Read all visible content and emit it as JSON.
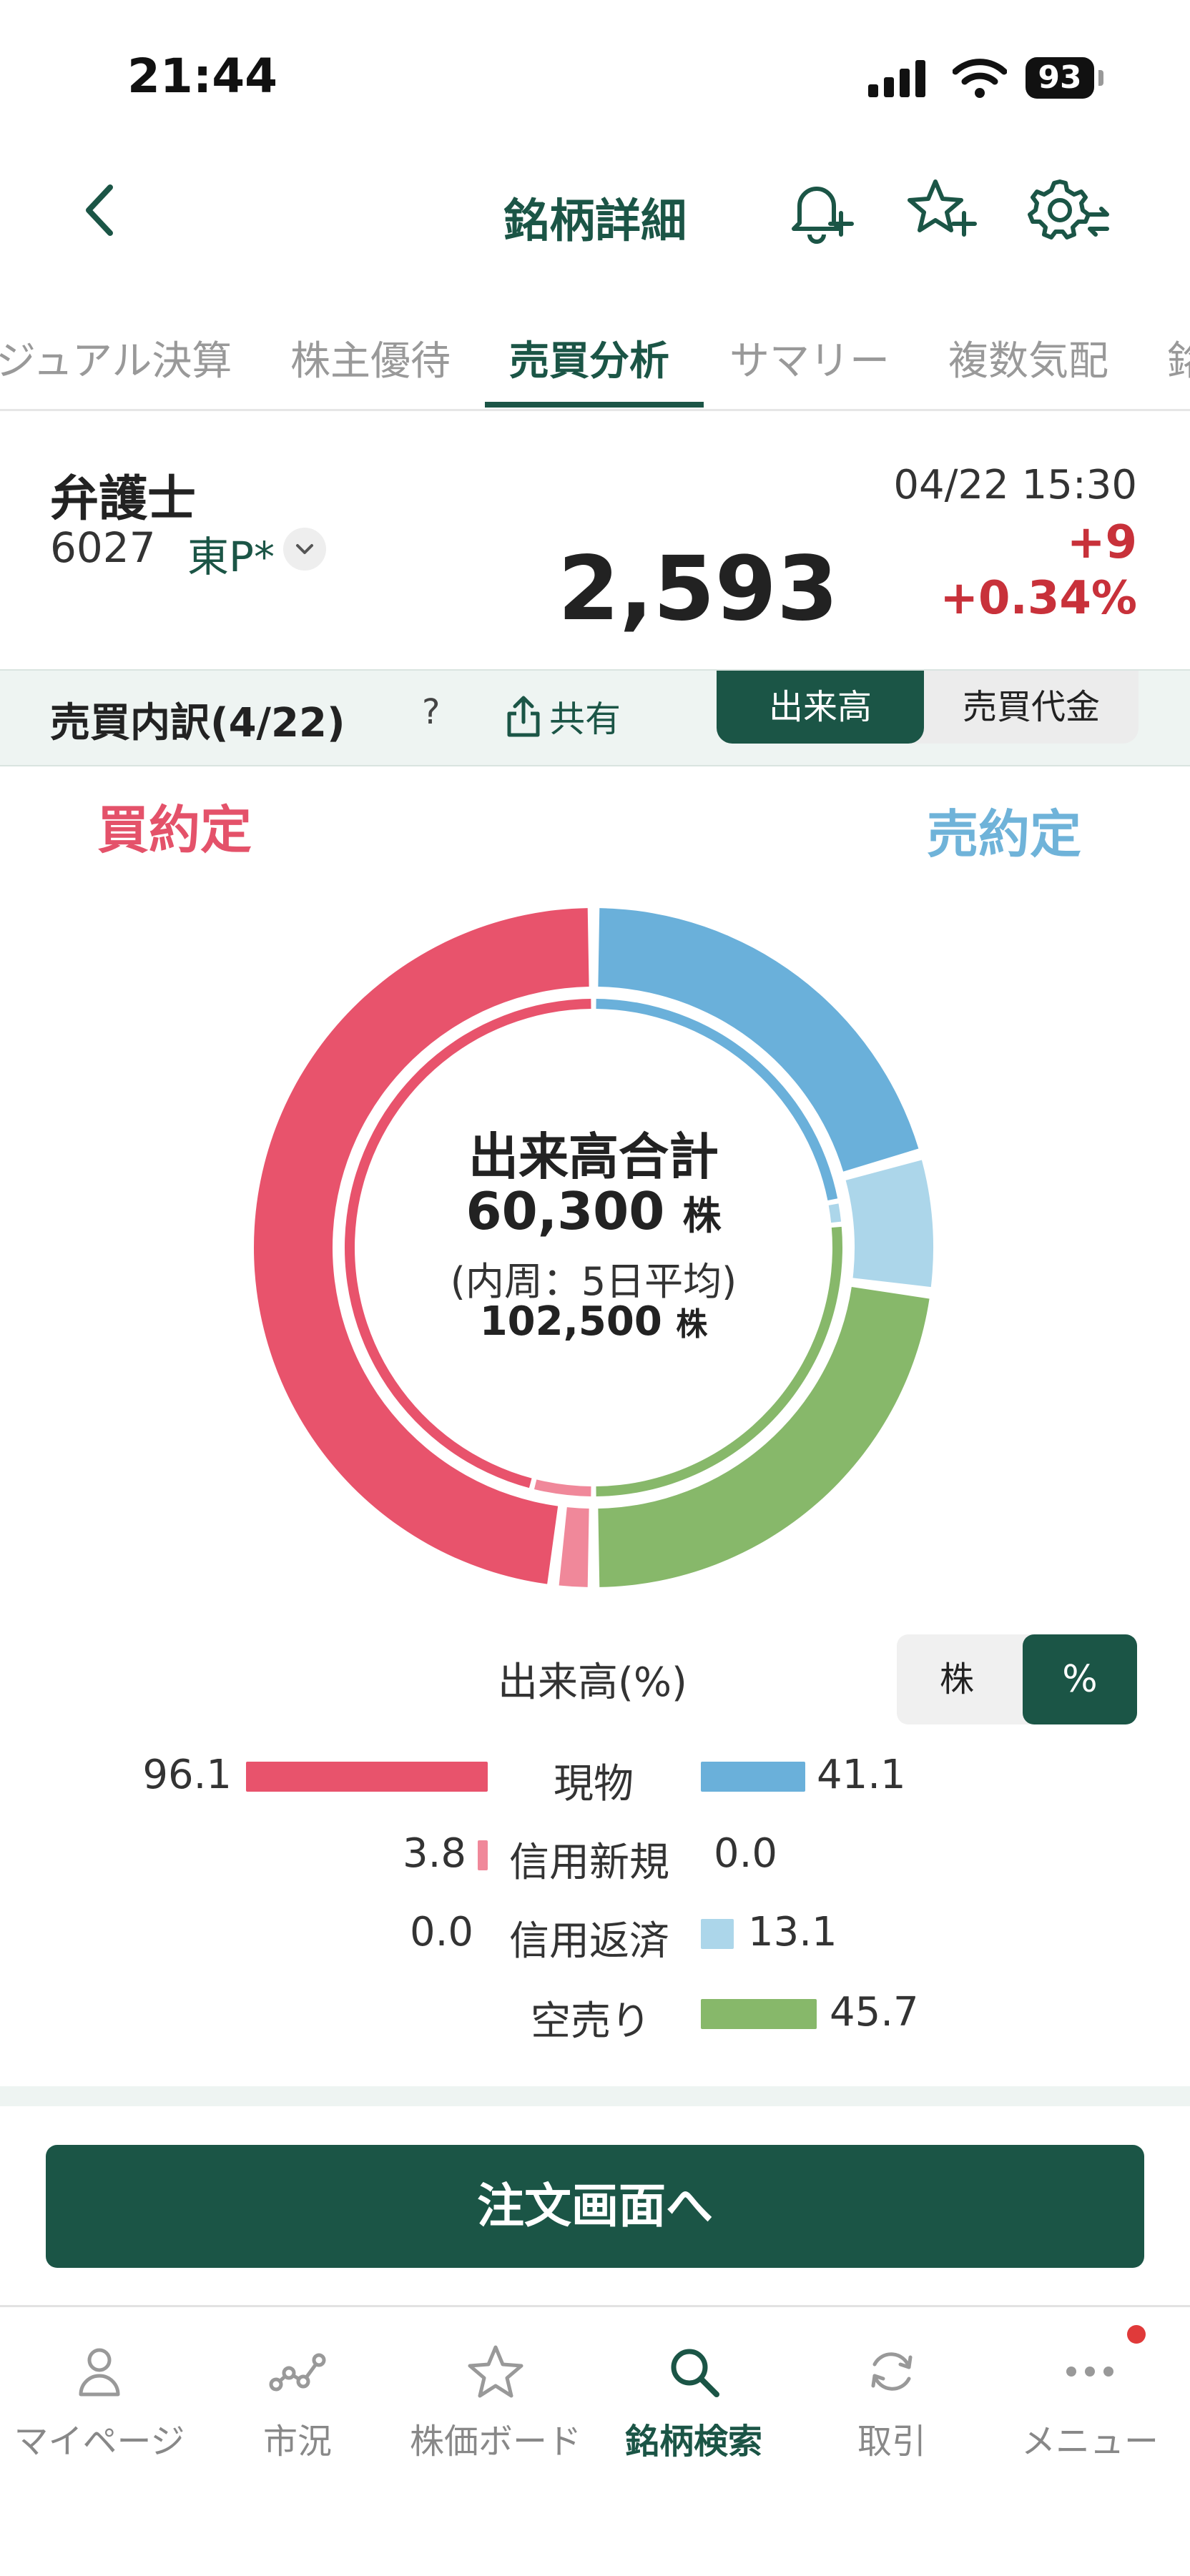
{
  "status_bar": {
    "time": "21:44",
    "battery": "93"
  },
  "header": {
    "title": "銘柄詳細"
  },
  "tabs": [
    {
      "label": "ジュアル決算"
    },
    {
      "label": "株主優待"
    },
    {
      "label": "売買分析",
      "active": true
    },
    {
      "label": "サマリー"
    },
    {
      "label": "複数気配"
    },
    {
      "label": "銘"
    }
  ],
  "stock": {
    "name": "弁護士",
    "code": "6027",
    "market": "東P*",
    "datetime": "04/22 15:30",
    "price": "2,593",
    "change": "+9",
    "change_pct": "+0.34%"
  },
  "section": {
    "title": "売買内訳(4/22)",
    "help": "?",
    "share_label": "共有",
    "seg_volume": "出来高",
    "seg_value": "売買代金"
  },
  "labels": {
    "buy": "買約定",
    "sell": "売約定"
  },
  "center": {
    "title": "出来高合計",
    "total": "60,300",
    "unit": "株",
    "note": "(内周：5日平均)",
    "avg_total": "102,500"
  },
  "breakdown": {
    "title": "出来高(%)",
    "toggle_shares": "株",
    "toggle_percent": "%",
    "rows": [
      {
        "label": "現物",
        "buy": "96.1",
        "sell": "41.1"
      },
      {
        "label": "信用新規",
        "buy": "3.8",
        "sell": "0.0"
      },
      {
        "label": "信用返済",
        "buy": "0.0",
        "sell": "13.1"
      },
      {
        "label": "空売り",
        "buy": "",
        "sell": "45.7"
      }
    ]
  },
  "chart_data": {
    "type": "donut",
    "title": "出来高合計",
    "series": [
      {
        "name": "出来高合計",
        "total": 60300,
        "segments": [
          {
            "label": "現物 (売)",
            "value": 41.1
          },
          {
            "label": "信用返済 (売)",
            "value": 13.1
          },
          {
            "label": "空売り",
            "value": 45.7
          },
          {
            "label": "信用新規 (買)",
            "value": 3.8
          },
          {
            "label": "現物 (買)",
            "value": 96.1
          }
        ]
      },
      {
        "name": "(内周：5日平均)",
        "total": 102500,
        "segments": [
          {
            "label": "現物 (売)",
            "value": 44
          },
          {
            "label": "信用返済 (売)",
            "value": 3
          },
          {
            "label": "空売り",
            "value": 53
          },
          {
            "label": "信用新規 (買)",
            "value": 8
          },
          {
            "label": "現物 (買)",
            "value": 92
          }
        ]
      }
    ]
  },
  "colors": {
    "brand": "#1b5546",
    "buy_cash": "#e8536c",
    "buy_margin_new": "#f0889a",
    "sell_cash": "#6ab0da",
    "sell_margin_close": "#acd6ea",
    "short_sell": "#87b86a",
    "negative": "#c8313a"
  },
  "order_button": {
    "label": "注文画面へ"
  },
  "bottom_nav": [
    {
      "label": "マイページ",
      "icon": "person-icon"
    },
    {
      "label": "市況",
      "icon": "market-chart-icon"
    },
    {
      "label": "株価ボード",
      "icon": "star-icon"
    },
    {
      "label": "銘柄検索",
      "icon": "search-icon",
      "active": true
    },
    {
      "label": "取引",
      "icon": "refresh-icon"
    },
    {
      "label": "メニュー",
      "icon": "more-icon"
    }
  ]
}
